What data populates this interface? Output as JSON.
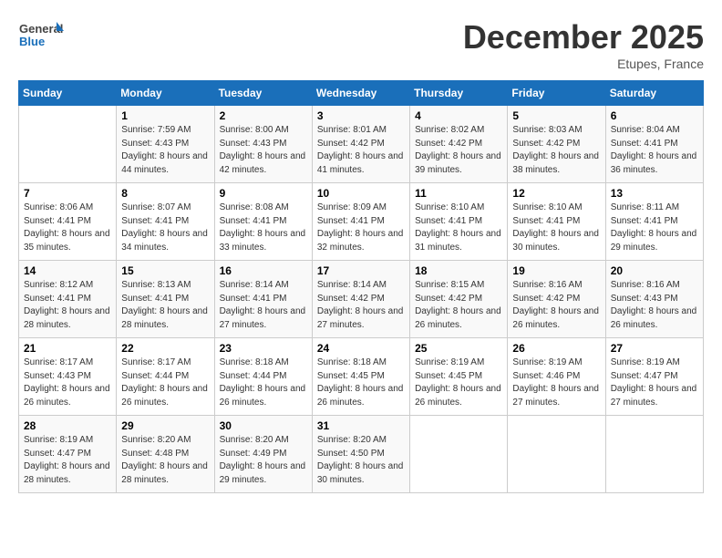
{
  "header": {
    "logo_line1": "General",
    "logo_line2": "Blue",
    "month_title": "December 2025",
    "location": "Etupes, France"
  },
  "weekdays": [
    "Sunday",
    "Monday",
    "Tuesday",
    "Wednesday",
    "Thursday",
    "Friday",
    "Saturday"
  ],
  "weeks": [
    [
      {
        "day": "",
        "sunrise": "",
        "sunset": "",
        "daylight": ""
      },
      {
        "day": "1",
        "sunrise": "Sunrise: 7:59 AM",
        "sunset": "Sunset: 4:43 PM",
        "daylight": "Daylight: 8 hours and 44 minutes."
      },
      {
        "day": "2",
        "sunrise": "Sunrise: 8:00 AM",
        "sunset": "Sunset: 4:43 PM",
        "daylight": "Daylight: 8 hours and 42 minutes."
      },
      {
        "day": "3",
        "sunrise": "Sunrise: 8:01 AM",
        "sunset": "Sunset: 4:42 PM",
        "daylight": "Daylight: 8 hours and 41 minutes."
      },
      {
        "day": "4",
        "sunrise": "Sunrise: 8:02 AM",
        "sunset": "Sunset: 4:42 PM",
        "daylight": "Daylight: 8 hours and 39 minutes."
      },
      {
        "day": "5",
        "sunrise": "Sunrise: 8:03 AM",
        "sunset": "Sunset: 4:42 PM",
        "daylight": "Daylight: 8 hours and 38 minutes."
      },
      {
        "day": "6",
        "sunrise": "Sunrise: 8:04 AM",
        "sunset": "Sunset: 4:41 PM",
        "daylight": "Daylight: 8 hours and 36 minutes."
      }
    ],
    [
      {
        "day": "7",
        "sunrise": "Sunrise: 8:06 AM",
        "sunset": "Sunset: 4:41 PM",
        "daylight": "Daylight: 8 hours and 35 minutes."
      },
      {
        "day": "8",
        "sunrise": "Sunrise: 8:07 AM",
        "sunset": "Sunset: 4:41 PM",
        "daylight": "Daylight: 8 hours and 34 minutes."
      },
      {
        "day": "9",
        "sunrise": "Sunrise: 8:08 AM",
        "sunset": "Sunset: 4:41 PM",
        "daylight": "Daylight: 8 hours and 33 minutes."
      },
      {
        "day": "10",
        "sunrise": "Sunrise: 8:09 AM",
        "sunset": "Sunset: 4:41 PM",
        "daylight": "Daylight: 8 hours and 32 minutes."
      },
      {
        "day": "11",
        "sunrise": "Sunrise: 8:10 AM",
        "sunset": "Sunset: 4:41 PM",
        "daylight": "Daylight: 8 hours and 31 minutes."
      },
      {
        "day": "12",
        "sunrise": "Sunrise: 8:10 AM",
        "sunset": "Sunset: 4:41 PM",
        "daylight": "Daylight: 8 hours and 30 minutes."
      },
      {
        "day": "13",
        "sunrise": "Sunrise: 8:11 AM",
        "sunset": "Sunset: 4:41 PM",
        "daylight": "Daylight: 8 hours and 29 minutes."
      }
    ],
    [
      {
        "day": "14",
        "sunrise": "Sunrise: 8:12 AM",
        "sunset": "Sunset: 4:41 PM",
        "daylight": "Daylight: 8 hours and 28 minutes."
      },
      {
        "day": "15",
        "sunrise": "Sunrise: 8:13 AM",
        "sunset": "Sunset: 4:41 PM",
        "daylight": "Daylight: 8 hours and 28 minutes."
      },
      {
        "day": "16",
        "sunrise": "Sunrise: 8:14 AM",
        "sunset": "Sunset: 4:41 PM",
        "daylight": "Daylight: 8 hours and 27 minutes."
      },
      {
        "day": "17",
        "sunrise": "Sunrise: 8:14 AM",
        "sunset": "Sunset: 4:42 PM",
        "daylight": "Daylight: 8 hours and 27 minutes."
      },
      {
        "day": "18",
        "sunrise": "Sunrise: 8:15 AM",
        "sunset": "Sunset: 4:42 PM",
        "daylight": "Daylight: 8 hours and 26 minutes."
      },
      {
        "day": "19",
        "sunrise": "Sunrise: 8:16 AM",
        "sunset": "Sunset: 4:42 PM",
        "daylight": "Daylight: 8 hours and 26 minutes."
      },
      {
        "day": "20",
        "sunrise": "Sunrise: 8:16 AM",
        "sunset": "Sunset: 4:43 PM",
        "daylight": "Daylight: 8 hours and 26 minutes."
      }
    ],
    [
      {
        "day": "21",
        "sunrise": "Sunrise: 8:17 AM",
        "sunset": "Sunset: 4:43 PM",
        "daylight": "Daylight: 8 hours and 26 minutes."
      },
      {
        "day": "22",
        "sunrise": "Sunrise: 8:17 AM",
        "sunset": "Sunset: 4:44 PM",
        "daylight": "Daylight: 8 hours and 26 minutes."
      },
      {
        "day": "23",
        "sunrise": "Sunrise: 8:18 AM",
        "sunset": "Sunset: 4:44 PM",
        "daylight": "Daylight: 8 hours and 26 minutes."
      },
      {
        "day": "24",
        "sunrise": "Sunrise: 8:18 AM",
        "sunset": "Sunset: 4:45 PM",
        "daylight": "Daylight: 8 hours and 26 minutes."
      },
      {
        "day": "25",
        "sunrise": "Sunrise: 8:19 AM",
        "sunset": "Sunset: 4:45 PM",
        "daylight": "Daylight: 8 hours and 26 minutes."
      },
      {
        "day": "26",
        "sunrise": "Sunrise: 8:19 AM",
        "sunset": "Sunset: 4:46 PM",
        "daylight": "Daylight: 8 hours and 27 minutes."
      },
      {
        "day": "27",
        "sunrise": "Sunrise: 8:19 AM",
        "sunset": "Sunset: 4:47 PM",
        "daylight": "Daylight: 8 hours and 27 minutes."
      }
    ],
    [
      {
        "day": "28",
        "sunrise": "Sunrise: 8:19 AM",
        "sunset": "Sunset: 4:47 PM",
        "daylight": "Daylight: 8 hours and 28 minutes."
      },
      {
        "day": "29",
        "sunrise": "Sunrise: 8:20 AM",
        "sunset": "Sunset: 4:48 PM",
        "daylight": "Daylight: 8 hours and 28 minutes."
      },
      {
        "day": "30",
        "sunrise": "Sunrise: 8:20 AM",
        "sunset": "Sunset: 4:49 PM",
        "daylight": "Daylight: 8 hours and 29 minutes."
      },
      {
        "day": "31",
        "sunrise": "Sunrise: 8:20 AM",
        "sunset": "Sunset: 4:50 PM",
        "daylight": "Daylight: 8 hours and 30 minutes."
      },
      {
        "day": "",
        "sunrise": "",
        "sunset": "",
        "daylight": ""
      },
      {
        "day": "",
        "sunrise": "",
        "sunset": "",
        "daylight": ""
      },
      {
        "day": "",
        "sunrise": "",
        "sunset": "",
        "daylight": ""
      }
    ]
  ]
}
